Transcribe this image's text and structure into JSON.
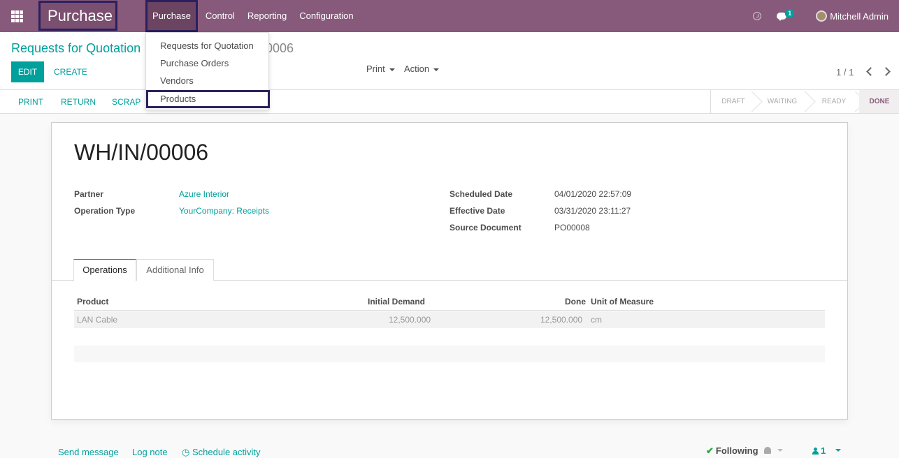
{
  "navbar": {
    "brand": "Purchase",
    "menu": [
      "Purchase",
      "Control",
      "Reporting",
      "Configuration"
    ],
    "chat_count": "1",
    "user": "Mitchell Admin"
  },
  "dropdown": {
    "items": [
      "Requests for Quotation",
      "Purchase Orders",
      "Vendors",
      "Products"
    ]
  },
  "control_panel": {
    "breadcrumb_parent": "Requests for Quotation",
    "breadcrumb_current": "00006",
    "edit_label": "EDIT",
    "create_label": "CREATE",
    "print_label": "Print",
    "action_label": "Action",
    "pager": "1 / 1"
  },
  "statusbar": {
    "buttons": [
      "PRINT",
      "RETURN",
      "SCRAP"
    ],
    "stages": [
      "DRAFT",
      "WAITING",
      "READY",
      "DONE"
    ],
    "active_stage": "DONE"
  },
  "record": {
    "name": "WH/IN/00006",
    "partner_label": "Partner",
    "partner": "Azure Interior",
    "operation_type_label": "Operation Type",
    "operation_type": "YourCompany: Receipts",
    "scheduled_date_label": "Scheduled Date",
    "scheduled_date": "04/01/2020 22:57:09",
    "effective_date_label": "Effective Date",
    "effective_date": "03/31/2020 23:11:27",
    "source_document_label": "Source Document",
    "source_document": "PO00008"
  },
  "tabs": [
    "Operations",
    "Additional Info"
  ],
  "table": {
    "headers": [
      "Product",
      "Initial Demand",
      "Done",
      "Unit of Measure"
    ],
    "rows": [
      {
        "product": "LAN Cable",
        "initial_demand": "12,500.000",
        "done": "12,500.000",
        "uom": "cm"
      }
    ]
  },
  "chatter": {
    "send_message": "Send message",
    "log_note": "Log note",
    "schedule_activity": "Schedule activity",
    "following": "Following",
    "followers_count": "1"
  },
  "colors": {
    "brand": "#875a7b",
    "accent": "#00a09d",
    "highlight_border": "#2c1f5f"
  }
}
